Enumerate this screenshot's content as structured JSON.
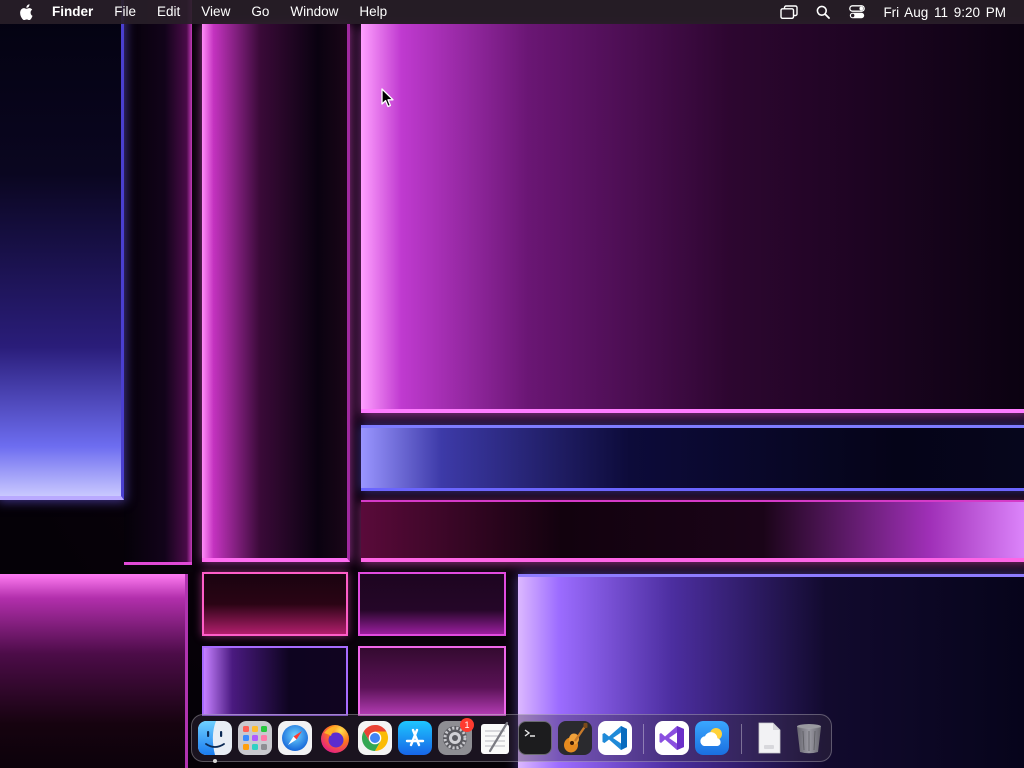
{
  "menubar": {
    "app_name": "Finder",
    "menus": [
      "File",
      "Edit",
      "View",
      "Go",
      "Window",
      "Help"
    ],
    "status_icons": [
      "screen-mirroring-icon",
      "search-icon",
      "control-center-icon"
    ],
    "clock": "Fri Aug 11  9:20 PM"
  },
  "dock": {
    "apps": [
      {
        "name": "finder",
        "icon": "finder-icon",
        "running": true
      },
      {
        "name": "launchpad",
        "icon": "launchpad-icon"
      },
      {
        "name": "safari",
        "icon": "safari-icon"
      },
      {
        "name": "firefox",
        "icon": "firefox-icon"
      },
      {
        "name": "chrome",
        "icon": "chrome-icon"
      },
      {
        "name": "app-store",
        "icon": "app-store-icon"
      },
      {
        "name": "system-settings",
        "icon": "system-settings-icon",
        "badge": "1"
      },
      {
        "name": "textedit",
        "icon": "textedit-icon"
      },
      {
        "name": "terminal",
        "icon": "terminal-icon"
      },
      {
        "name": "garageband",
        "icon": "garageband-icon"
      },
      {
        "name": "vscode",
        "icon": "vscode-icon"
      }
    ],
    "recent": [
      {
        "name": "visual-studio",
        "icon": "visual-studio-icon"
      },
      {
        "name": "weather",
        "icon": "weather-icon"
      }
    ],
    "extras": [
      {
        "name": "document",
        "icon": "document-icon"
      },
      {
        "name": "trash",
        "icon": "trash-icon"
      }
    ]
  },
  "colors": {
    "menubar_bg": "#281e28",
    "wallpaper_pink": "#ff7dff",
    "wallpaper_violet": "#8e7cff"
  }
}
